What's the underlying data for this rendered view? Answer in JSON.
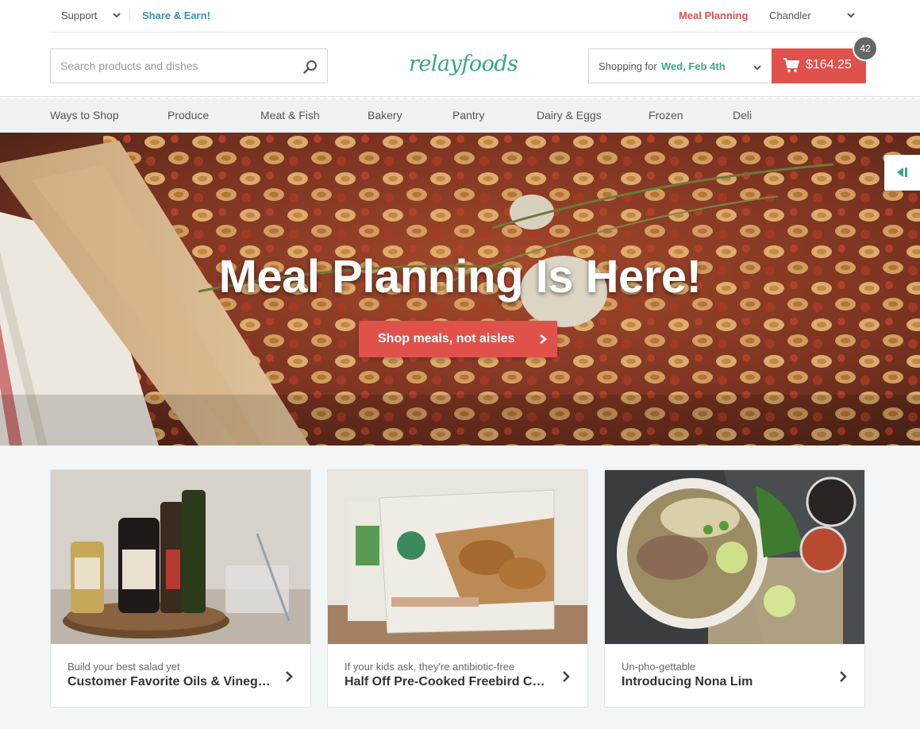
{
  "topbar": {
    "support_label": "Support",
    "share_label": "Share & Earn!",
    "meal_planning_label": "Meal Planning",
    "location_label": "Chandler"
  },
  "header": {
    "search_placeholder": "Search products and dishes",
    "logo_text": "relayfoods",
    "shopping_for_label": "Shopping for",
    "shopping_date": "Wed, Feb 4th",
    "cart_total": "$164.25",
    "cart_count": "42"
  },
  "nav": {
    "items": [
      "Ways to Shop",
      "Produce",
      "Meat & Fish",
      "Bakery",
      "Pantry",
      "Dairy & Eggs",
      "Frozen",
      "Deli"
    ]
  },
  "hero": {
    "title": "Meal Planning Is Here!",
    "cta_label": "Shop meals, not aisles"
  },
  "cards": [
    {
      "subtitle": "Build your best salad yet",
      "title": "Customer Favorite Oils & Vinegars"
    },
    {
      "subtitle": "If your kids ask, they're antibiotic-free",
      "title": "Half Off Pre-Cooked Freebird Chicken Nuggets"
    },
    {
      "subtitle": "Un-pho-gettable",
      "title": "Introducing Nona Lim"
    }
  ],
  "colors": {
    "accent_red": "#e0514c",
    "brand_green": "#3aa585",
    "link_blue": "#3b8fb5"
  },
  "icons": {
    "search": "search-icon",
    "cart": "cart-icon",
    "chevron": "chevron-down-icon",
    "arrow": "chevron-right-icon",
    "side_tab": "collapse-panel-icon"
  }
}
